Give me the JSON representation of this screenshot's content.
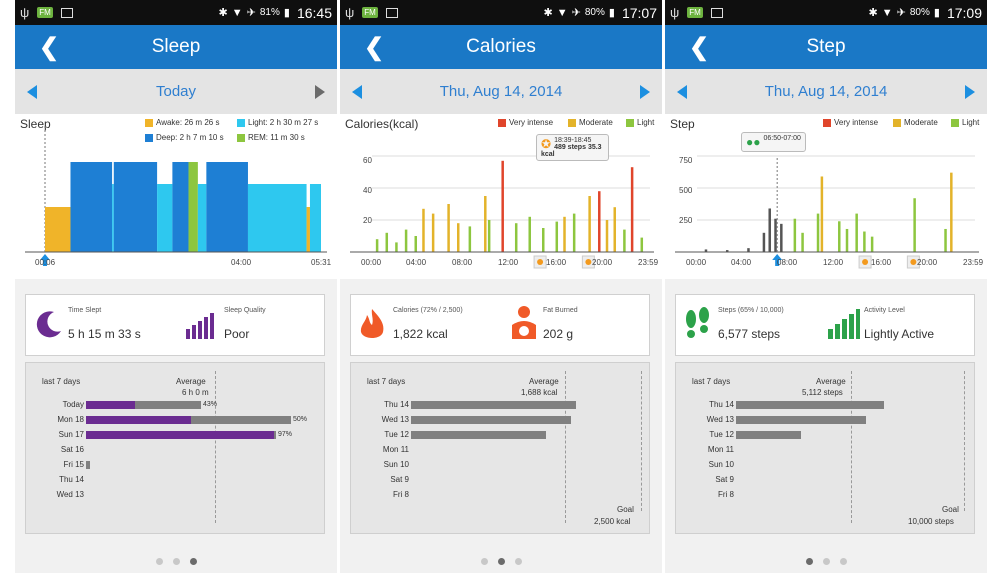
{
  "status": [
    {
      "battery": "81%",
      "time": "16:45",
      "fm": "FM"
    },
    {
      "battery": "80%",
      "time": "17:07",
      "fm": "FM"
    },
    {
      "battery": "80%",
      "time": "17:09",
      "fm": "FM"
    }
  ],
  "screens": [
    {
      "title": "Sleep",
      "date": "Today",
      "chart_title": "Sleep",
      "legend": [
        "Awake: 26 m 26 s",
        "Light: 2 h 30 m 27 s",
        "Deep: 2 h 7 m 10 s",
        "REM: 11 m 30 s"
      ],
      "legend_colors": [
        "#f0b429",
        "#2ec8ef",
        "#1e7fd4",
        "#8dc63f"
      ],
      "xticks": [
        "00:06",
        "04:00",
        "05:31"
      ],
      "summary": {
        "a_label": "Time Slept",
        "a_value": "5 h 15 m 33 s",
        "b_label": "Sleep Quality",
        "b_value": "Poor"
      },
      "history": {
        "period": "last 7 days",
        "avg_label": "Average",
        "avg_value": "6 h 0 m",
        "goal_label": "",
        "goal_value": "",
        "rows": [
          {
            "day": "Today",
            "pct": "43%"
          },
          {
            "day": "Mon 18",
            "pct": "50%"
          },
          {
            "day": "Sun 17",
            "pct": "97%"
          },
          {
            "day": "Sat 16",
            "pct": ""
          },
          {
            "day": "Fri 15",
            "pct": ""
          },
          {
            "day": "Thu 14",
            "pct": ""
          },
          {
            "day": "Wed 13",
            "pct": ""
          }
        ]
      }
    },
    {
      "title": "Calories",
      "date": "Thu, Aug 14, 2014",
      "chart_title": "Calories(kcal)",
      "legend": [
        "Very intense",
        "Moderate",
        "Light"
      ],
      "legend_colors": [
        "#e0452b",
        "#e3b32a",
        "#8dc63f"
      ],
      "yticks": [
        "60",
        "40",
        "20"
      ],
      "xticks": [
        "00:00",
        "04:00",
        "08:00",
        "12:00",
        "16:00",
        "20:00",
        "23:59"
      ],
      "callout": {
        "time": "18:39-18:45",
        "steps": "489 steps",
        "kcal": "35.3 kcal"
      },
      "summary": {
        "a_label": "Calories (72% / 2,500)",
        "a_value": "1,822 kcal",
        "b_label": "Fat Burned",
        "b_value": "202 g"
      },
      "history": {
        "period": "last 7 days",
        "avg_label": "Average",
        "avg_value": "1,688 kcal",
        "goal_label": "Goal",
        "goal_value": "2,500 kcal",
        "rows": [
          {
            "day": "Thu 14",
            "pct": ""
          },
          {
            "day": "Wed 13",
            "pct": ""
          },
          {
            "day": "Tue 12",
            "pct": ""
          },
          {
            "day": "Mon 11",
            "pct": ""
          },
          {
            "day": "Sun 10",
            "pct": ""
          },
          {
            "day": "Sat 9",
            "pct": ""
          },
          {
            "day": "Fri 8",
            "pct": ""
          }
        ]
      }
    },
    {
      "title": "Step",
      "date": "Thu, Aug 14, 2014",
      "chart_title": "Step",
      "legend": [
        "Very intense",
        "Moderate",
        "Light"
      ],
      "legend_colors": [
        "#e0452b",
        "#e3b32a",
        "#8dc63f"
      ],
      "yticks": [
        "750",
        "500",
        "250"
      ],
      "xticks": [
        "00:00",
        "04:00",
        "08:00",
        "12:00",
        "16:00",
        "20:00",
        "23:59"
      ],
      "callout": {
        "time": "06:50-07:00"
      },
      "summary": {
        "a_label": "Steps (65% / 10,000)",
        "a_value": "6,577 steps",
        "b_label": "Activity Level",
        "b_value": "Lightly Active"
      },
      "history": {
        "period": "last 7 days",
        "avg_label": "Average",
        "avg_value": "5,112 steps",
        "goal_label": "Goal",
        "goal_value": "10,000 steps",
        "rows": [
          {
            "day": "Thu 14",
            "pct": ""
          },
          {
            "day": "Wed 13",
            "pct": ""
          },
          {
            "day": "Tue 12",
            "pct": ""
          },
          {
            "day": "Mon 11",
            "pct": ""
          },
          {
            "day": "Sun 10",
            "pct": ""
          },
          {
            "day": "Sat 9",
            "pct": ""
          },
          {
            "day": "Fri 8",
            "pct": ""
          }
        ]
      }
    }
  ],
  "chart_data": [
    {
      "type": "bar",
      "title": "Sleep",
      "stages": [
        {
          "stage": "Awake",
          "start": "00:06",
          "end": "00:36"
        },
        {
          "stage": "Deep",
          "start": "00:36",
          "end": "01:25"
        },
        {
          "stage": "Light",
          "start": "01:25",
          "end": "01:27"
        },
        {
          "stage": "Deep",
          "start": "01:27",
          "end": "02:18"
        },
        {
          "stage": "Light",
          "start": "02:18",
          "end": "02:36"
        },
        {
          "stage": "Deep",
          "start": "02:36",
          "end": "02:55"
        },
        {
          "stage": "REM",
          "start": "02:55",
          "end": "03:06"
        },
        {
          "stage": "Light",
          "start": "03:06",
          "end": "03:16"
        },
        {
          "stage": "Deep",
          "start": "03:16",
          "end": "04:05"
        },
        {
          "stage": "Light",
          "start": "04:05",
          "end": "05:14"
        },
        {
          "stage": "Awake",
          "start": "05:14",
          "end": "05:18"
        },
        {
          "stage": "Light",
          "start": "05:18",
          "end": "05:31"
        }
      ],
      "xlabel": "",
      "ylabel": ""
    },
    {
      "type": "bar",
      "title": "Calories(kcal)",
      "ylim": [
        0,
        70
      ],
      "series": [
        {
          "name": "Very intense",
          "x": [
            "11:10",
            "19:30",
            "22:20"
          ],
          "values": [
            57,
            38,
            53
          ]
        },
        {
          "name": "Moderate",
          "x": [
            "04:20",
            "05:10",
            "06:30",
            "07:20",
            "09:40",
            "16:30",
            "18:40",
            "20:10",
            "20:50"
          ],
          "values": [
            27,
            24,
            30,
            18,
            35,
            22,
            35,
            20,
            28
          ]
        },
        {
          "name": "Light",
          "x": [
            "00:20",
            "01:10",
            "02:00",
            "02:50",
            "03:40",
            "08:20",
            "10:00",
            "12:20",
            "13:30",
            "14:40",
            "15:50",
            "17:20",
            "21:40",
            "23:10"
          ],
          "values": [
            8,
            12,
            6,
            14,
            10,
            16,
            20,
            18,
            22,
            15,
            19,
            24,
            14,
            9
          ]
        }
      ]
    },
    {
      "type": "bar",
      "title": "Step",
      "ylim": [
        0,
        875
      ],
      "series": [
        {
          "name": "Very intense",
          "x": [],
          "values": []
        },
        {
          "name": "Moderate",
          "x": [
            "10:40",
            "21:50"
          ],
          "values": [
            590,
            620
          ]
        },
        {
          "name": "Light",
          "x": [
            "08:20",
            "09:00",
            "10:20",
            "12:10",
            "12:50",
            "13:40",
            "14:20",
            "15:00",
            "18:40",
            "21:20"
          ],
          "values": [
            260,
            150,
            300,
            240,
            180,
            300,
            160,
            120,
            420,
            180
          ]
        },
        {
          "name": "Inactive",
          "x": [
            "00:40",
            "02:30",
            "04:20",
            "05:40",
            "06:10",
            "06:40",
            "07:10"
          ],
          "values": [
            20,
            15,
            30,
            150,
            340,
            260,
            220
          ]
        }
      ]
    }
  ]
}
